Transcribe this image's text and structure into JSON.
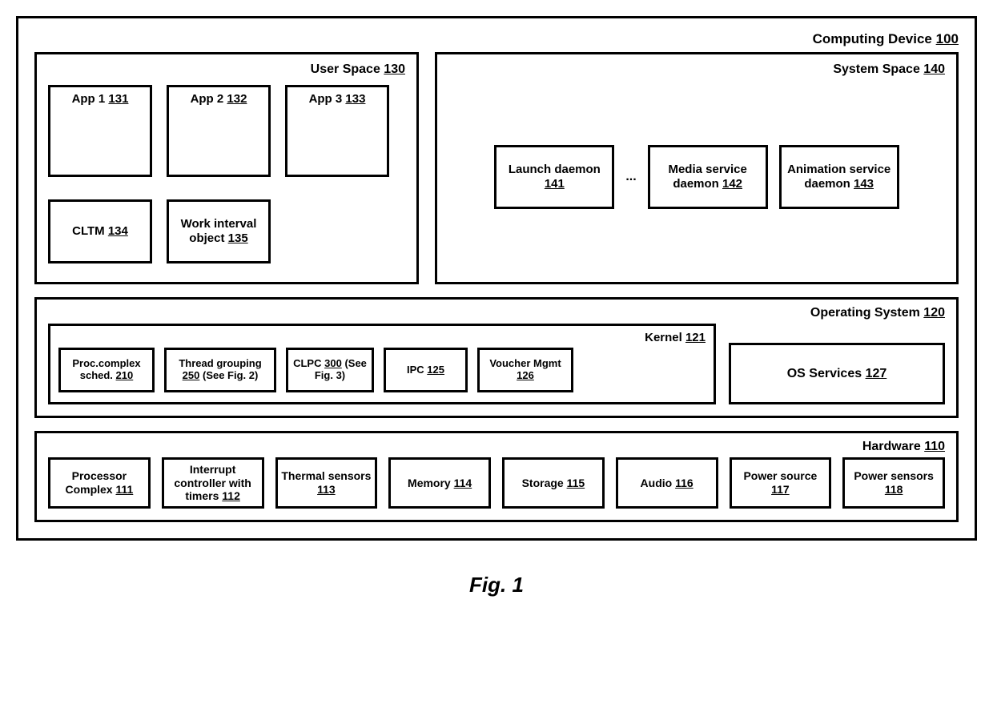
{
  "device": {
    "label": "Computing Device",
    "ref": "100"
  },
  "user_space": {
    "label": "User Space",
    "ref": "130",
    "apps": [
      {
        "label": "App 1",
        "ref": "131"
      },
      {
        "label": "App 2",
        "ref": "132"
      },
      {
        "label": "App 3",
        "ref": "133"
      }
    ],
    "cltm": {
      "label": "CLTM",
      "ref": "134"
    },
    "work_interval": {
      "label": "Work interval object",
      "ref": "135"
    }
  },
  "system_space": {
    "label": "System Space",
    "ref": "140",
    "launch": {
      "label": "Launch daemon",
      "ref": "141"
    },
    "ellipsis": "...",
    "media": {
      "label": "Media service daemon",
      "ref": "142"
    },
    "animation": {
      "label": "Animation service daemon",
      "ref": "143"
    }
  },
  "os": {
    "label": "Operating System",
    "ref": "120",
    "kernel": {
      "label": "Kernel",
      "ref": "121",
      "proc_sched": {
        "label": "Proc.complex sched.",
        "ref": "210"
      },
      "thread_group": {
        "label": "Thread grouping",
        "ref": "250",
        "note": "(See Fig. 2)"
      },
      "clpc": {
        "label": "CLPC",
        "ref": "300",
        "note": "(See Fig. 3)"
      },
      "ipc": {
        "label": "IPC",
        "ref": "125"
      },
      "voucher": {
        "label": "Voucher Mgmt",
        "ref": "126"
      }
    },
    "services": {
      "label": "OS Services",
      "ref": "127"
    }
  },
  "hardware": {
    "label": "Hardware",
    "ref": "110",
    "items": [
      {
        "label": "Processor Complex",
        "ref": "111"
      },
      {
        "label": "Interrupt controller with timers",
        "ref": "112"
      },
      {
        "label": "Thermal sensors",
        "ref": "113"
      },
      {
        "label": "Memory",
        "ref": "114"
      },
      {
        "label": "Storage",
        "ref": "115"
      },
      {
        "label": "Audio",
        "ref": "116"
      },
      {
        "label": "Power source",
        "ref": "117"
      },
      {
        "label": "Power sensors",
        "ref": "118"
      }
    ]
  },
  "figure_caption": "Fig. 1"
}
